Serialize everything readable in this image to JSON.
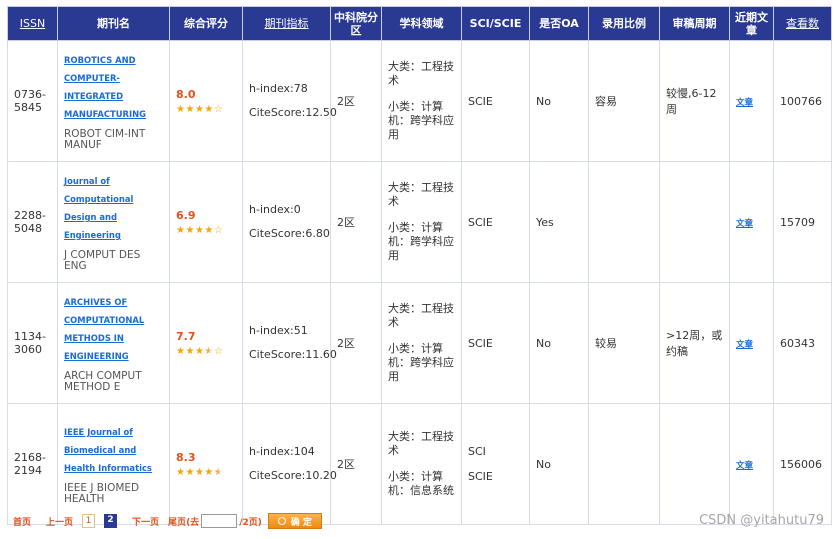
{
  "headers": {
    "issn": "ISSN",
    "name": "期刊名",
    "score": "综合评分",
    "metrics": "期刊指标",
    "cas": "中科院分区",
    "field": "学科领域",
    "sci": "SCI/SCIE",
    "oa": "是否OA",
    "accept": "录用比例",
    "review": "审稿周期",
    "recent": "近期文章",
    "views": "查看数"
  },
  "rows": [
    {
      "issn_a": "0736-",
      "issn_b": "5845",
      "name_lines": [
        "ROBOTICS AND",
        "COMPUTER-",
        "INTEGRATED",
        "MANUFACTURING"
      ],
      "abbr": "ROBOT CIM-INT MANUF",
      "score": "8.0",
      "stars": 4,
      "hindex": "h-index:78",
      "citescore": "CiteScore:12.50",
      "cas": "2区",
      "major": "大类：工程技术",
      "minor": "小类：计算机：跨学科应用",
      "sci": [
        "SCIE"
      ],
      "oa": "No",
      "accept": "容易",
      "review": "较慢,6-12周",
      "recent": "文章",
      "views": "100766"
    },
    {
      "issn_a": "2288-",
      "issn_b": "5048",
      "name_lines": [
        "Journal of",
        "Computational",
        "Design and",
        "Engineering"
      ],
      "abbr": "J COMPUT DES ENG",
      "score": "6.9",
      "stars": 4,
      "hindex": "h-index:0",
      "citescore": "CiteScore:6.80",
      "cas": "2区",
      "major": "大类：工程技术",
      "minor": "小类：计算机：跨学科应用",
      "sci": [
        "SCIE"
      ],
      "oa": "Yes",
      "accept": "",
      "review": "",
      "recent": "文章",
      "views": "15709"
    },
    {
      "issn_a": "1134-",
      "issn_b": "3060",
      "name_lines": [
        "ARCHIVES OF",
        "COMPUTATIONAL",
        "METHODS IN",
        "ENGINEERING"
      ],
      "abbr": "ARCH COMPUT METHOD E",
      "score": "7.7",
      "stars": 3.5,
      "hindex": "h-index:51",
      "citescore": "CiteScore:11.60",
      "cas": "2区",
      "major": "大类：工程技术",
      "minor": "小类：计算机：跨学科应用",
      "sci": [
        "SCIE"
      ],
      "oa": "No",
      "accept": "较易",
      "review": ">12周，或约稿",
      "recent": "文章",
      "views": "60343"
    },
    {
      "issn_a": "2168-",
      "issn_b": "2194",
      "name_lines": [
        "IEEE Journal of",
        "Biomedical and",
        "Health Informatics"
      ],
      "abbr": "IEEE J BIOMED HEALTH",
      "score": "8.3",
      "stars": 4.5,
      "hindex": "h-index:104",
      "citescore": "CiteScore:10.20",
      "cas": "2区",
      "major": "大类：工程技术",
      "minor": "小类：计算机：信息系统",
      "sci": [
        "SCI",
        "SCIE"
      ],
      "oa": "No",
      "accept": "",
      "review": "",
      "recent": "文章",
      "views": "156006"
    }
  ],
  "pager": {
    "first": "首页",
    "prev": "上一页",
    "page1": "1",
    "page2": "2",
    "next": "下一页",
    "last": "尾页",
    "goto_prefix": "(去",
    "goto_suffix": "/2页)",
    "go_button": "确 定"
  },
  "watermark": "CSDN @yitahutu79",
  "colors": {
    "header_bg": "#2a3a92",
    "link": "#1a6bd6",
    "score": "#e0531c",
    "star": "#f2a70a"
  }
}
